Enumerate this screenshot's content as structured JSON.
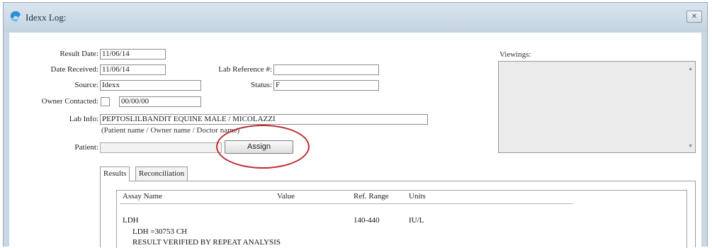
{
  "window": {
    "title": "Idexx Log:",
    "close_glyph": "✕",
    "app_icon": "app-logo-icon"
  },
  "form": {
    "result_date": {
      "label": "Result Date:",
      "value": "11/06/14"
    },
    "date_received": {
      "label": "Date Received:",
      "value": "11/06/14"
    },
    "source": {
      "label": "Source:",
      "value": "Idexx"
    },
    "owner_contacted": {
      "label": "Owner Contacted:",
      "checked": false,
      "value": "00/00/00"
    },
    "lab_reference": {
      "label": "Lab Reference #:",
      "value": ""
    },
    "status": {
      "label": "Status:",
      "value": "F"
    },
    "lab_info": {
      "label": "Lab Info:",
      "value": "PEPTOSLILBANDIT EQUINE MALE /  MICOLAZZI",
      "hint": "(Patient name / Owner name / Doctor name)"
    },
    "patient": {
      "label": "Patient:",
      "value": ""
    },
    "assign_label": "Assign"
  },
  "viewings": {
    "label": "Viewings:",
    "scroll_up": "▲",
    "scroll_down": "▼"
  },
  "tabs": [
    {
      "label": "Results",
      "active": true
    },
    {
      "label": "Reconciliation",
      "active": false
    }
  ],
  "results": {
    "columns": [
      "Assay Name",
      "Value",
      "Ref. Range",
      "Units"
    ],
    "rows": [
      {
        "assay": "LDH",
        "value": "",
        "ref_range": "140-440",
        "units": "IU/L",
        "detail_1": "LDH =30753 CH",
        "detail_2": "RESULT VERIFIED BY REPEAT ANALYSIS"
      }
    ]
  },
  "colors": {
    "annotation_circle": "#c0282e",
    "titlebar": "#c9d6e3"
  }
}
